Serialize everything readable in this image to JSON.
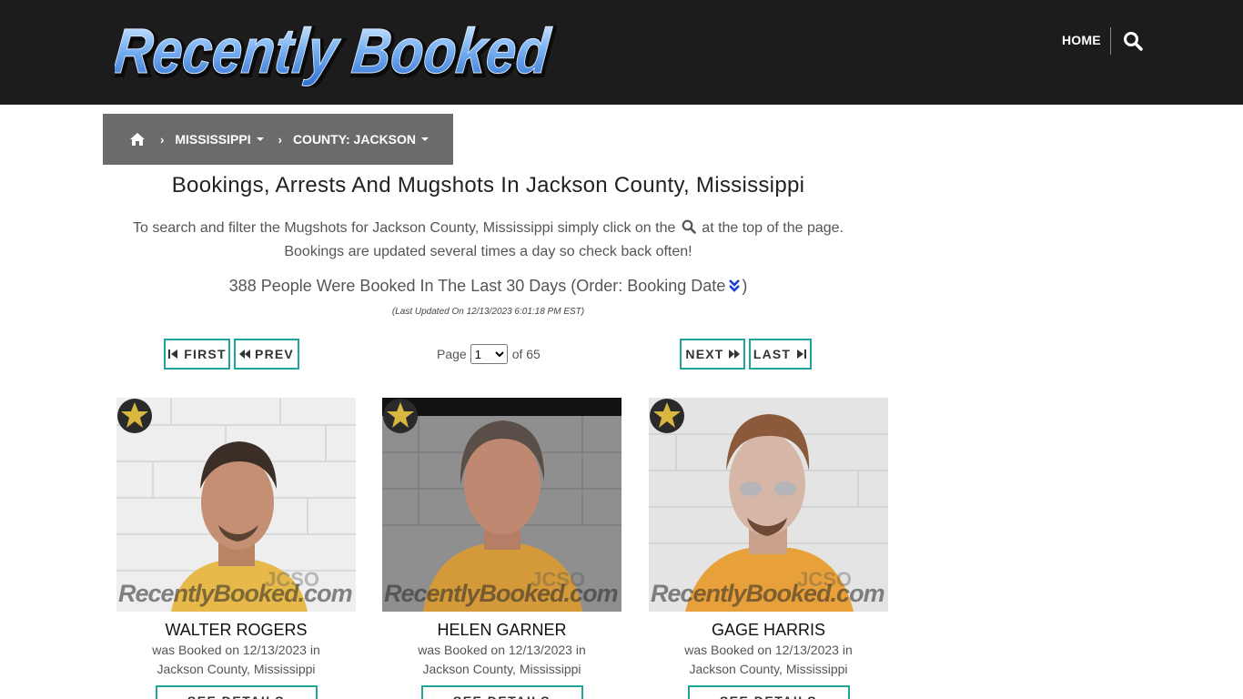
{
  "header": {
    "logo_text": "Recently Booked",
    "nav_home": "HOME",
    "search_icon": "search-icon"
  },
  "breadcrumb": {
    "home_icon": "home-icon",
    "state": "MISSISSIPPI",
    "county": "COUNTY: JACKSON"
  },
  "main": {
    "title": "Bookings, Arrests And Mugshots In Jackson County, Mississippi",
    "intro_part1": "To search and filter the Mugshots for Jackson County, Mississippi simply click on the",
    "intro_part2": "at the top of the page.",
    "intro_line2": "Bookings are updated several times a day so check back often!",
    "count_text": "388 People Were Booked In The Last 30 Days (Order: Booking Date",
    "count_close": ")",
    "last_updated": "(Last Updated On 12/13/2023 6:01:18 PM EST)"
  },
  "pagination": {
    "first": "FIRST",
    "prev": "PREV",
    "next": "NEXT",
    "last": "LAST",
    "page_label": "Page",
    "current_page": "1",
    "of_label": "of 65"
  },
  "people": [
    {
      "name": "WALTER ROGERS",
      "line1": "was Booked on 12/13/2023 in",
      "line2": "Jackson County, Mississippi",
      "button": "SEE DETAILS",
      "watermark": "RecentlyBooked.com",
      "jcso": "JCSO"
    },
    {
      "name": "HELEN GARNER",
      "line1": "was Booked on 12/13/2023 in",
      "line2": "Jackson County, Mississippi",
      "button": "SEE DETAILS",
      "watermark": "RecentlyBooked.com",
      "jcso": "JCSO"
    },
    {
      "name": "GAGE HARRIS",
      "line1": "was Booked on 12/13/2023 in",
      "line2": "Jackson County, Mississippi",
      "button": "SEE DETAILS",
      "watermark": "RecentlyBooked.com",
      "jcso": "JCSO"
    }
  ],
  "colors": {
    "header_bg": "#1c1c1c",
    "breadcrumb_bg": "#6b6b6b",
    "accent_teal": "#1fa59a",
    "logo_blue": "#5aa0f0"
  }
}
